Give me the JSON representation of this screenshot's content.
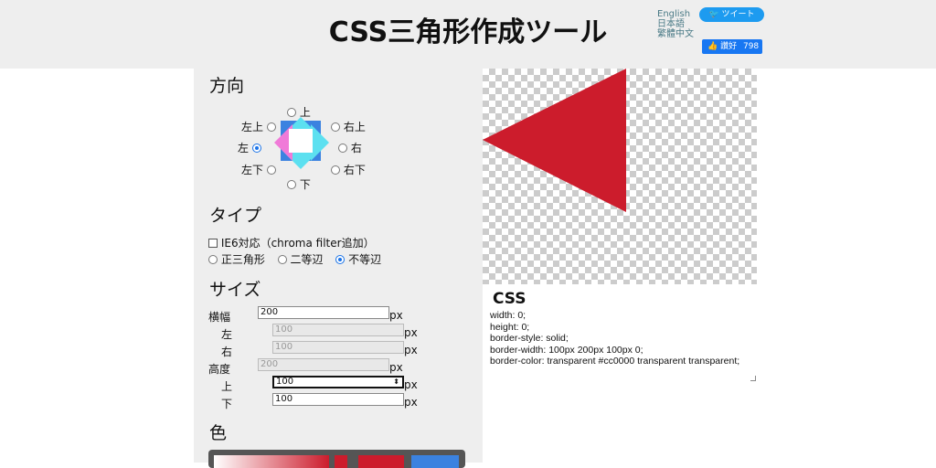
{
  "header": {
    "title": "CSS三角形作成ツール",
    "languages": [
      "English",
      "日本語",
      "繁體中文"
    ],
    "tweet_label": "ツイート",
    "like_label": "讚好",
    "like_count": "798"
  },
  "direction": {
    "title": "方向",
    "options": {
      "top": "上",
      "top_left": "左上",
      "top_right": "右上",
      "left": "左",
      "right": "右",
      "bottom_left": "左下",
      "bottom_right": "右下",
      "bottom": "下"
    },
    "selected": "left"
  },
  "type": {
    "title": "タイプ",
    "ie6_label": "IE6対応（chroma filter追加）",
    "ie6_checked": false,
    "options": [
      "正三角形",
      "二等辺",
      "不等辺"
    ],
    "selected": "不等辺"
  },
  "size": {
    "title": "サイズ",
    "width_label": "横幅",
    "width_value": "200",
    "left_label": "左",
    "left_value": "100",
    "right_label": "右",
    "right_value": "100",
    "height_label": "高度",
    "height_value": "200",
    "top_label": "上",
    "top_value": "100",
    "bottom_label": "下",
    "bottom_value": "100",
    "unit": "px"
  },
  "color": {
    "title": "色",
    "value": "#cc0000"
  },
  "css_output": {
    "title": "CSS",
    "code": "width: 0;\nheight: 0;\nborder-style: solid;\nborder-width: 100px 200px 100px 0;\nborder-color: transparent #cc0000 transparent transparent;"
  },
  "colors": {
    "triangle": "#cc1c2c",
    "indicator_blue": "#3b82e0",
    "indicator_cyan": "#5ce0f0",
    "indicator_pink": "#f07ad8"
  }
}
